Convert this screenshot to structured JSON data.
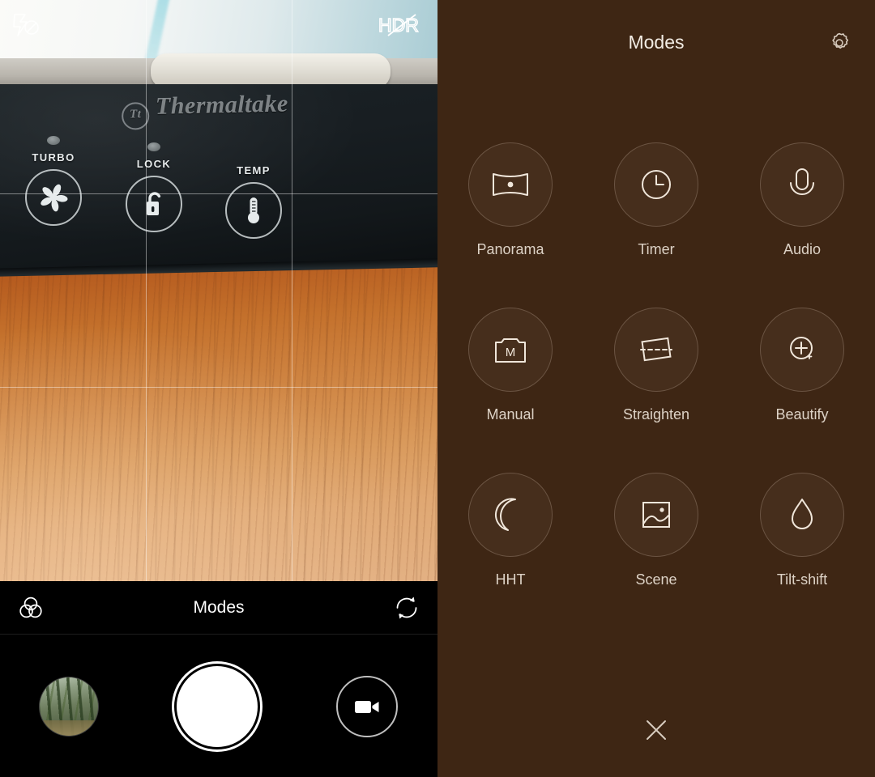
{
  "camera": {
    "flash_icon": "flash-off-icon",
    "hdr_icon": "hdr-off-icon",
    "hdr_label": "HDR",
    "toolbar": {
      "filter_icon": "color-filter-icon",
      "title": "Modes",
      "switch_icon": "switch-camera-icon"
    },
    "actions": {
      "gallery_icon": "gallery-thumbnail",
      "shutter_icon": "shutter-button",
      "video_icon": "video-camera-icon"
    },
    "scene": {
      "brand": "Thermaltake",
      "brand_mark": "Tt",
      "buttons": [
        {
          "label": "TURBO",
          "icon": "fan-icon"
        },
        {
          "label": "LOCK",
          "icon": "padlock-icon"
        },
        {
          "label": "TEMP",
          "icon": "thermometer-icon"
        }
      ]
    }
  },
  "modes_panel": {
    "title": "Modes",
    "settings_icon": "gear-icon",
    "close_icon": "close-icon",
    "background_color": "#3e2614",
    "text_color": "#ddd2c6",
    "items": [
      {
        "label": "Panorama",
        "icon": "panorama-icon"
      },
      {
        "label": "Timer",
        "icon": "timer-clock-icon"
      },
      {
        "label": "Audio",
        "icon": "microphone-icon"
      },
      {
        "label": "Manual",
        "icon": "manual-camera-icon"
      },
      {
        "label": "Straighten",
        "icon": "straighten-icon"
      },
      {
        "label": "Beautify",
        "icon": "beautify-sparkle-icon"
      },
      {
        "label": "HHT",
        "icon": "moon-icon"
      },
      {
        "label": "Scene",
        "icon": "picture-icon"
      },
      {
        "label": "Tilt-shift",
        "icon": "droplet-icon"
      }
    ]
  }
}
